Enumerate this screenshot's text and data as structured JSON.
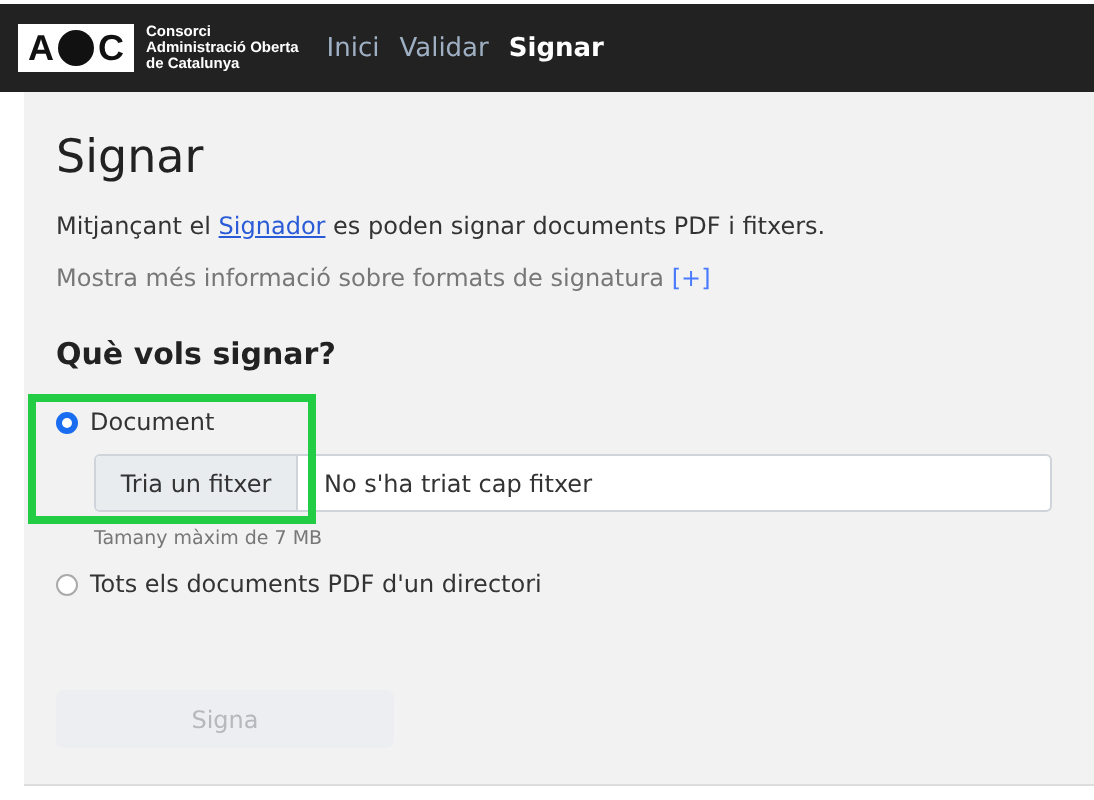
{
  "header": {
    "logo": {
      "letter_left": "A",
      "letter_right": "C",
      "org_lines": [
        "Consorci",
        "Administració Oberta",
        "de Catalunya"
      ]
    },
    "nav": [
      {
        "label": "Inici",
        "selected": false
      },
      {
        "label": "Validar",
        "selected": false
      },
      {
        "label": "Signar",
        "selected": true
      }
    ]
  },
  "page": {
    "title": "Signar",
    "intro": {
      "before": "Mitjançant el ",
      "link": "Signador",
      "after": " es poden signar documents PDF i fitxers."
    },
    "more_info": {
      "text": "Mostra més informació sobre formats de signatura",
      "link": "[+]"
    },
    "question": "Què vols signar?",
    "options": [
      {
        "label": "Document",
        "selected": true,
        "file_button": "Tria un fitxer",
        "file_status": "No s'ha triat cap fitxer",
        "hint": "Tamany màxim de 7 MB"
      },
      {
        "label": "Tots els documents PDF d'un directori",
        "selected": false
      }
    ],
    "submit": {
      "label": "Signa",
      "disabled": true
    }
  },
  "annotation": {
    "kind": "highlight-frame"
  }
}
